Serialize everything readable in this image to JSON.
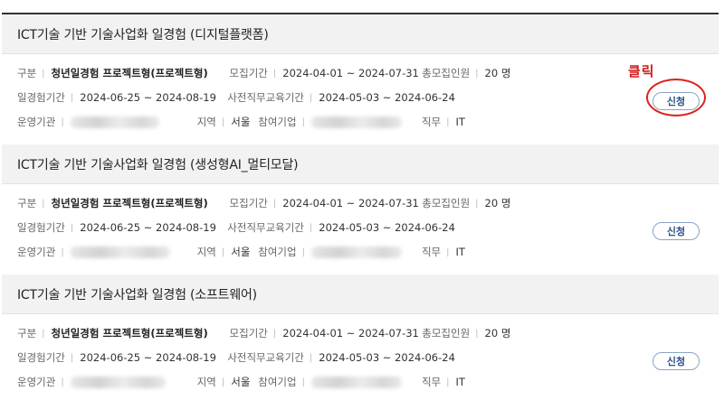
{
  "annotation": {
    "text": "클릭",
    "color": "#d21a1a"
  },
  "labels": {
    "type": "구분",
    "recruit_period": "모집기간",
    "total_recruit": "총모집인원",
    "exp_period": "일경험기간",
    "pre_edu_period": "사전직무교육기간",
    "operator": "운영기관",
    "region": "지역",
    "company": "참여기업",
    "job": "직무",
    "separator": "|"
  },
  "cards": [
    {
      "title": "ICT기술 기반 기술사업화 일경험 (디지털플랫폼)",
      "type": "청년일경험 프로젝트형(프로젝트형)",
      "recruit_period": "2024-04-01 ~ 2024-07-31",
      "total_recruit": "20 명",
      "exp_period": "2024-06-25 ~ 2024-08-19",
      "pre_edu_period": "2024-05-03 ~ 2024-06-24",
      "region": "서울",
      "job": "IT",
      "button": "신청"
    },
    {
      "title": "ICT기술 기반 기술사업화 일경험 (생성형AI_멀티모달)",
      "type": "청년일경험 프로젝트형(프로젝트형)",
      "recruit_period": "2024-04-01 ~ 2024-07-31",
      "total_recruit": "20 명",
      "exp_period": "2024-06-25 ~ 2024-08-19",
      "pre_edu_period": "2024-05-03 ~ 2024-06-24",
      "region": "서울",
      "job": "IT",
      "button": "신청"
    },
    {
      "title": "ICT기술 기반 기술사업화 일경험 (소프트웨어)",
      "type": "청년일경험 프로젝트형(프로젝트형)",
      "recruit_period": "2024-04-01 ~ 2024-07-31",
      "total_recruit": "20 명",
      "exp_period": "2024-06-25 ~ 2024-08-19",
      "pre_edu_period": "2024-05-03 ~ 2024-06-24",
      "region": "서울",
      "job": "IT",
      "button": "신청"
    }
  ]
}
